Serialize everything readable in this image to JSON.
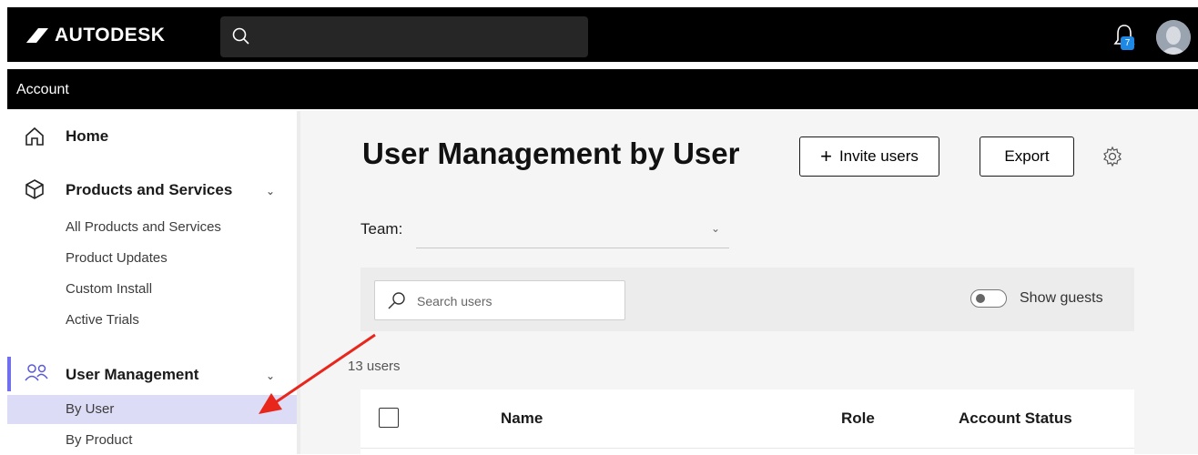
{
  "header": {
    "brand": "AUTODESK",
    "notification_count": "7"
  },
  "subheader": {
    "title": "Account"
  },
  "sidebar": {
    "items": [
      {
        "label": "Home",
        "icon": "home-icon"
      },
      {
        "label": "Products and Services",
        "icon": "cube-icon",
        "expanded": true,
        "children": [
          "All Products and Services",
          "Product Updates",
          "Custom Install",
          "Active Trials"
        ]
      },
      {
        "label": "User Management",
        "icon": "users-icon",
        "expanded": true,
        "active": true,
        "children": [
          "By User",
          "By Product"
        ]
      }
    ],
    "selected_child": "By User"
  },
  "main": {
    "title": "User Management by User",
    "invite_label": "Invite users",
    "export_label": "Export",
    "team_label": "Team:",
    "team_value": "",
    "search_placeholder": "Search users",
    "show_guests_label": "Show guests",
    "show_guests_on": false,
    "users_count": "13 users",
    "table_columns": [
      "Name",
      "Role",
      "Account Status"
    ]
  },
  "colors": {
    "header_bg": "#000000",
    "active_accent": "#6f6ff0",
    "selected_bg": "#dcdcf7",
    "annotation_arrow": "#e8261c"
  }
}
